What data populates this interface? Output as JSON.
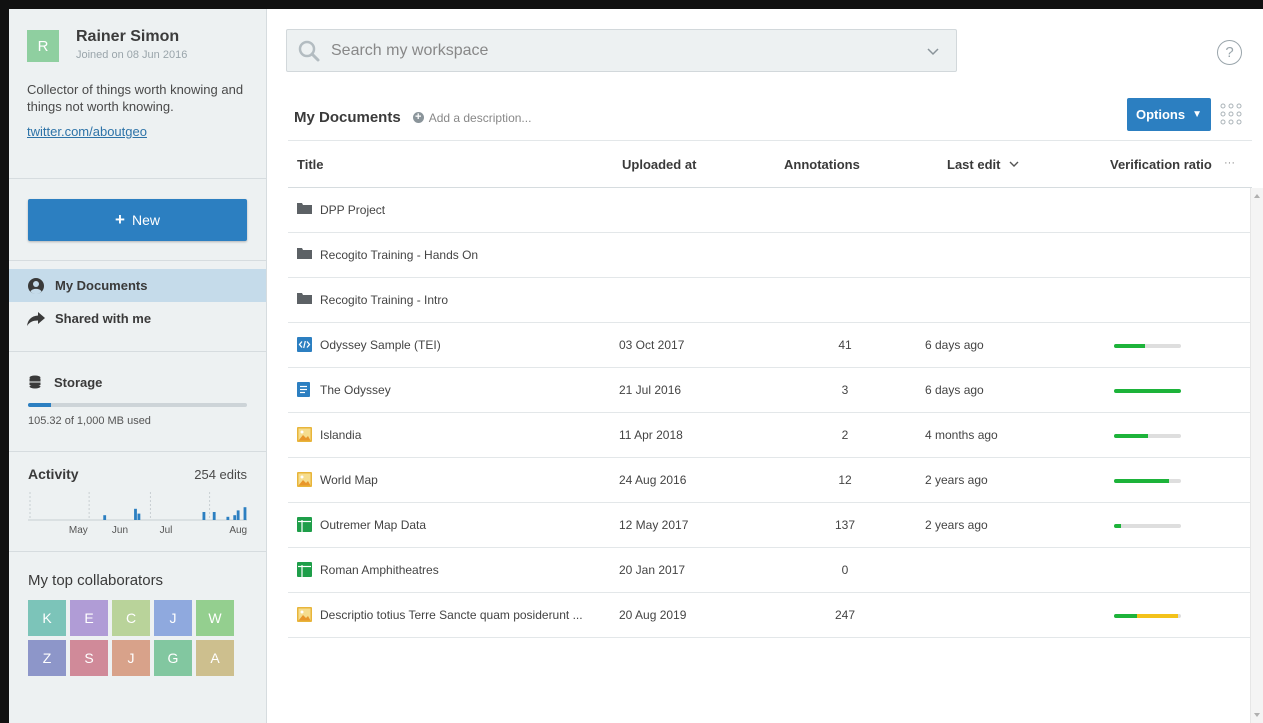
{
  "user": {
    "initial": "R",
    "name": "Rainer Simon",
    "joined": "Joined on 08 Jun 2016",
    "bio": "Collector of things worth knowing and things not worth knowing.",
    "link": "twitter.com/aboutgeo"
  },
  "new_button": {
    "label": "New"
  },
  "nav": {
    "my_documents": "My Documents",
    "shared": "Shared with me"
  },
  "storage": {
    "title": "Storage",
    "used_text": "105.32 of 1,000 MB used",
    "fraction": 0.105
  },
  "activity": {
    "title": "Activity",
    "count": "254 edits",
    "months": [
      "May",
      "Jun",
      "Jul",
      "Aug"
    ],
    "bars": [
      0,
      0,
      0,
      0,
      0,
      0,
      0,
      0,
      0,
      0,
      0,
      0,
      0,
      0,
      0,
      0,
      0,
      0,
      0,
      0,
      0,
      0,
      0.3,
      0,
      0,
      0,
      0,
      0,
      0,
      0,
      0,
      0.7,
      0.4,
      0,
      0,
      0,
      0,
      0,
      0,
      0,
      0,
      0,
      0,
      0,
      0,
      0,
      0,
      0,
      0,
      0,
      0,
      0.5,
      0,
      0,
      0.5,
      0,
      0,
      0,
      0.2,
      0,
      0.3,
      0.6,
      0,
      0.8
    ]
  },
  "collaborators": {
    "title": "My top collaborators",
    "items": [
      {
        "letter": "K",
        "color": "#7cc4b9"
      },
      {
        "letter": "E",
        "color": "#b09cd6"
      },
      {
        "letter": "C",
        "color": "#b9d39a"
      },
      {
        "letter": "J",
        "color": "#8fa9de"
      },
      {
        "letter": "W",
        "color": "#94cf8f"
      },
      {
        "letter": "Z",
        "color": "#8d96c9"
      },
      {
        "letter": "S",
        "color": "#d08a99"
      },
      {
        "letter": "J",
        "color": "#d8a28a"
      },
      {
        "letter": "G",
        "color": "#82c7a0"
      },
      {
        "letter": "A",
        "color": "#cdbf8e"
      }
    ]
  },
  "search": {
    "placeholder": "Search my workspace"
  },
  "help": "?",
  "documents": {
    "title": "My Documents",
    "add_description": "Add a description...",
    "options_label": "Options",
    "columns": {
      "title": "Title",
      "uploaded": "Uploaded at",
      "annotations": "Annotations",
      "last_edit": "Last edit",
      "verification": "Verification ratio",
      "more": "···"
    },
    "rows": [
      {
        "type": "folder",
        "title": "DPP Project",
        "uploaded": "",
        "annotations": "",
        "last_edit": "",
        "ratio": null
      },
      {
        "type": "folder",
        "title": "Recogito Training - Hands On",
        "uploaded": "",
        "annotations": "",
        "last_edit": "",
        "ratio": null
      },
      {
        "type": "folder",
        "title": "Recogito Training - Intro",
        "uploaded": "",
        "annotations": "",
        "last_edit": "",
        "ratio": null
      },
      {
        "type": "tei",
        "title": "Odyssey Sample (TEI)",
        "uploaded": "03 Oct 2017",
        "annotations": "41",
        "last_edit": "6 days ago",
        "ratio": {
          "green": 0.46,
          "yellow": 0
        }
      },
      {
        "type": "text",
        "title": "The Odyssey",
        "uploaded": "21 Jul 2016",
        "annotations": "3",
        "last_edit": "6 days ago",
        "ratio": {
          "green": 1.0,
          "yellow": 0
        }
      },
      {
        "type": "image",
        "title": "Islandia",
        "uploaded": "11 Apr 2018",
        "annotations": "2",
        "last_edit": "4 months ago",
        "ratio": {
          "green": 0.5,
          "yellow": 0
        }
      },
      {
        "type": "image",
        "title": "World Map",
        "uploaded": "24 Aug 2016",
        "annotations": "12",
        "last_edit": "2 years ago",
        "ratio": {
          "green": 0.82,
          "yellow": 0
        }
      },
      {
        "type": "table",
        "title": "Outremer Map Data",
        "uploaded": "12 May 2017",
        "annotations": "137",
        "last_edit": "2 years ago",
        "ratio": {
          "green": 0.1,
          "yellow": 0
        }
      },
      {
        "type": "table",
        "title": "Roman Amphitheatres",
        "uploaded": "20 Jan 2017",
        "annotations": "0",
        "last_edit": "",
        "ratio": null
      },
      {
        "type": "image",
        "title": "Descriptio totius Terre Sancte quam posiderunt ...",
        "uploaded": "20 Aug 2019",
        "annotations": "247",
        "last_edit": "",
        "ratio": {
          "green": 0.35,
          "yellow": 0.6
        }
      }
    ]
  },
  "colors": {
    "accent": "#2c7fc1",
    "green": "#1db33a",
    "yellow": "#f3c21a"
  }
}
